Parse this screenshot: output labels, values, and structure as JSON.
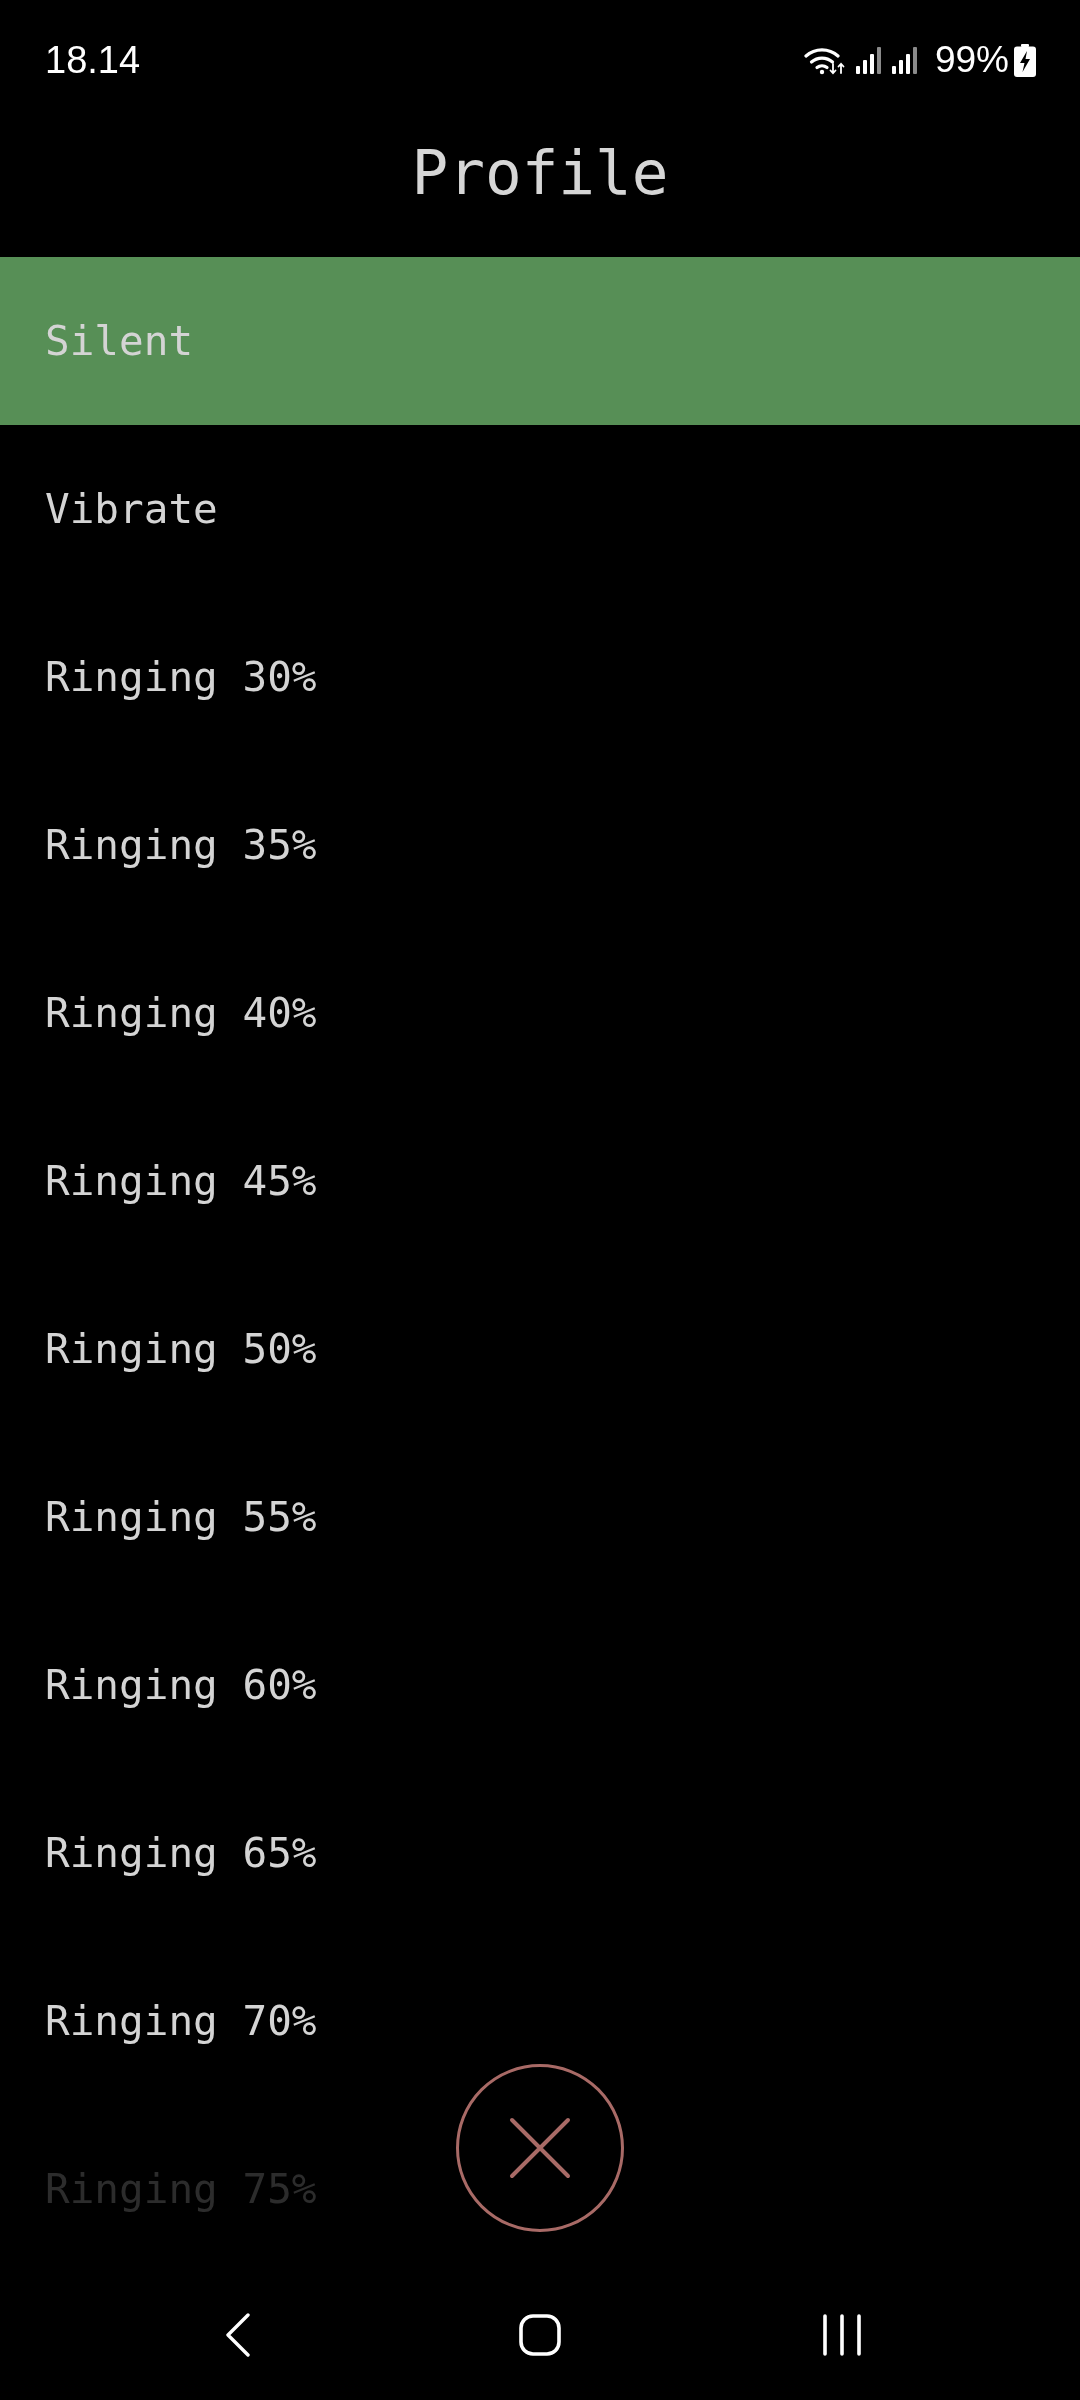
{
  "status_bar": {
    "time": "18.14",
    "battery": "99%"
  },
  "title": "Profile",
  "profiles": [
    {
      "label": "Silent",
      "selected": true,
      "dimmed": false
    },
    {
      "label": "Vibrate",
      "selected": false,
      "dimmed": false
    },
    {
      "label": "Ringing 30%",
      "selected": false,
      "dimmed": false
    },
    {
      "label": "Ringing 35%",
      "selected": false,
      "dimmed": false
    },
    {
      "label": "Ringing 40%",
      "selected": false,
      "dimmed": false
    },
    {
      "label": "Ringing 45%",
      "selected": false,
      "dimmed": false
    },
    {
      "label": "Ringing 50%",
      "selected": false,
      "dimmed": false
    },
    {
      "label": "Ringing 55%",
      "selected": false,
      "dimmed": false
    },
    {
      "label": "Ringing 60%",
      "selected": false,
      "dimmed": false
    },
    {
      "label": "Ringing 65%",
      "selected": false,
      "dimmed": false
    },
    {
      "label": "Ringing 70%",
      "selected": false,
      "dimmed": false
    },
    {
      "label": "Ringing 75%",
      "selected": false,
      "dimmed": true
    }
  ]
}
